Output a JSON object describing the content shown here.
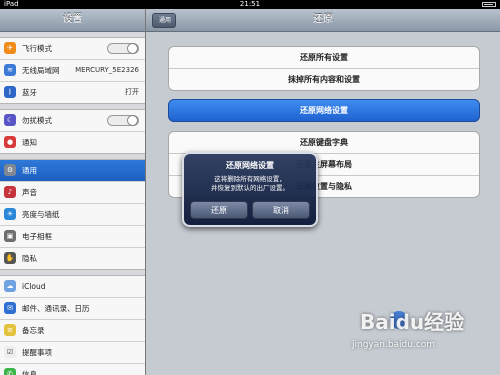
{
  "status_bar": {
    "time": "21:51",
    "left": "iPad"
  },
  "sidebar": {
    "title": "设置",
    "groups": [
      [
        {
          "label": "飞行模式",
          "icon": "airplane-icon",
          "color": "#f08c1a",
          "toggle": true
        },
        {
          "label": "无线局域网",
          "icon": "wifi-icon",
          "color": "#3b7ad6",
          "value": "MERCURY_5E2326"
        },
        {
          "label": "蓝牙",
          "icon": "bluetooth-icon",
          "color": "#2f67c9",
          "value": "打开"
        }
      ],
      [
        {
          "label": "勿扰模式",
          "icon": "moon-icon",
          "color": "#5a55c7",
          "toggle": true
        },
        {
          "label": "通知",
          "icon": "notifications-icon",
          "color": "#d83a3a"
        }
      ],
      [
        {
          "label": "通用",
          "icon": "gear-icon",
          "color": "#7f8793",
          "selected": true
        },
        {
          "label": "声音",
          "icon": "speaker-icon",
          "color": "#c5333b"
        },
        {
          "label": "亮度与墙纸",
          "icon": "brightness-icon",
          "color": "#2b87d9"
        },
        {
          "label": "电子相框",
          "icon": "picture-frame-icon",
          "color": "#6d6d6d"
        },
        {
          "label": "隐私",
          "icon": "hand-icon",
          "color": "#555555"
        }
      ],
      [
        {
          "label": "iCloud",
          "icon": "cloud-icon",
          "color": "#6fa2e0"
        },
        {
          "label": "邮件、通讯录、日历",
          "icon": "mail-icon",
          "color": "#2e6fd1"
        },
        {
          "label": "备忘录",
          "icon": "notes-icon",
          "color": "#e3c23e"
        },
        {
          "label": "提醒事项",
          "icon": "reminders-icon",
          "color": "#eeeeee"
        },
        {
          "label": "信息",
          "icon": "messages-icon",
          "color": "#3bb54a"
        }
      ]
    ]
  },
  "main": {
    "title": "还原",
    "back_label": "通用",
    "group1": [
      "还原所有设置",
      "抹掉所有内容和设置"
    ],
    "group2": [
      "还原网络设置"
    ],
    "group3": [
      "还原键盘字典",
      "还原主屏幕布局",
      "还原位置与隐私"
    ]
  },
  "alert": {
    "title": "还原网络设置",
    "message_line1": "这将删除所有网络设置，",
    "message_line2": "并恢复到默认的出厂设置。",
    "confirm_label": "还原",
    "cancel_label": "取消"
  },
  "watermark": {
    "text": "Baidu经验",
    "url": "jingyan.baidu.com"
  }
}
